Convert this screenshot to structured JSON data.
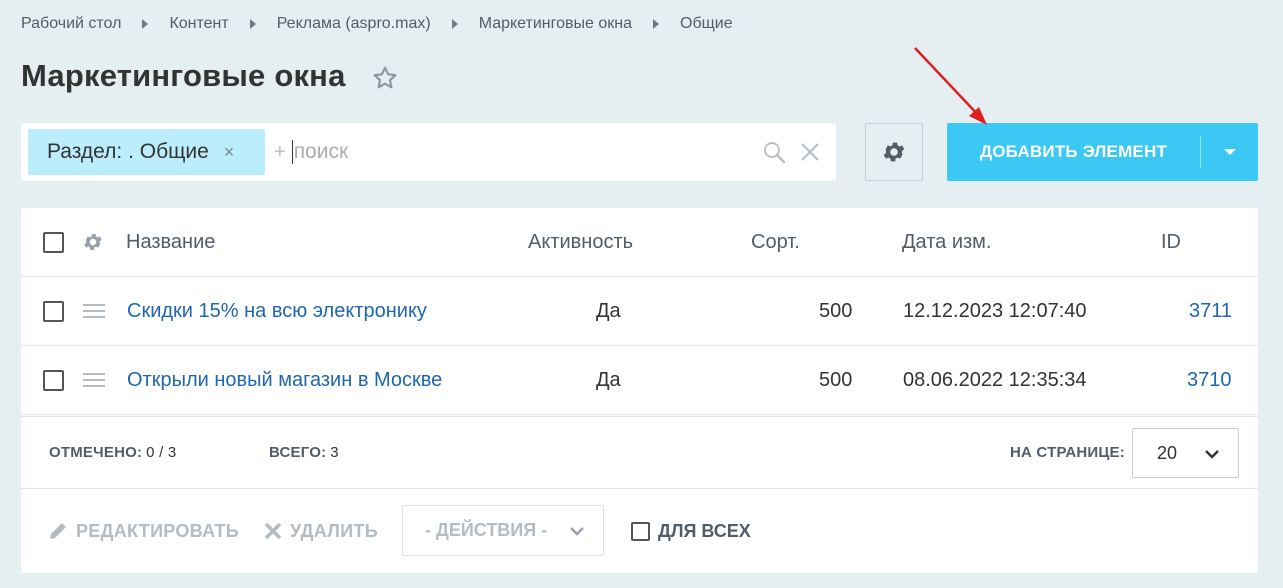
{
  "breadcrumb": [
    "Рабочий стол",
    "Контент",
    "Реклама (aspro.max)",
    "Маркетинговые окна",
    "Общие"
  ],
  "page_title": "Маркетинговые окна",
  "filter": {
    "tag_label": "Раздел: . Общие",
    "tag_close": "×",
    "plus": "+",
    "placeholder": "поиск"
  },
  "toolbar": {
    "add_label": "ДОБАВИТЬ ЭЛЕМЕНТ"
  },
  "grid": {
    "columns": [
      "Название",
      "Активность",
      "Сорт.",
      "Дата изм.",
      "ID"
    ],
    "rows": [
      {
        "name": "Скидки 15% на всю электронику",
        "active": "Да",
        "sort": "500",
        "date": "12.12.2023 12:07:40",
        "id": "3711"
      },
      {
        "name": "Открыли новый магазин в Москве",
        "active": "Да",
        "sort": "500",
        "date": "08.06.2022 12:35:34",
        "id": "3710"
      }
    ]
  },
  "footer": {
    "selected_label": "ОТМЕЧЕНО:",
    "selected_value": "0 / 3",
    "total_label": "ВСЕГО:",
    "total_value": "3",
    "per_page_label": "НА СТРАНИЦЕ:",
    "per_page_value": "20"
  },
  "actions": {
    "edit": "РЕДАКТИРОВАТЬ",
    "delete": "УДАЛИТЬ",
    "select": "- ДЕЙСТВИЯ -",
    "for_all": "ДЛЯ ВСЕХ"
  },
  "colors": {
    "accent": "#3bc8f5",
    "link": "#2067b0",
    "tag_bg": "#bcedfc",
    "annotation_arrow": "#e02020"
  }
}
